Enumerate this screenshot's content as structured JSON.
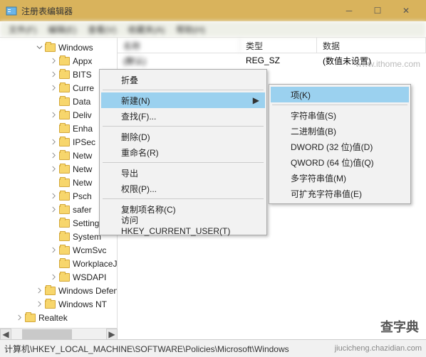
{
  "window": {
    "title": "注册表编辑器"
  },
  "menubar": [
    "文件(F)",
    "编辑(E)",
    "查看(V)",
    "收藏夹(A)",
    "帮助(H)"
  ],
  "tree": {
    "root": "Windows",
    "items": [
      {
        "l": "Appx",
        "e": true
      },
      {
        "l": "BITS",
        "e": true
      },
      {
        "l": "Curre",
        "e": true
      },
      {
        "l": "Data",
        "e": false
      },
      {
        "l": "Deliv",
        "e": true
      },
      {
        "l": "Enha",
        "e": false
      },
      {
        "l": "IPSec",
        "e": true
      },
      {
        "l": "Netw",
        "e": true
      },
      {
        "l": "Netw",
        "e": true
      },
      {
        "l": "Netw",
        "e": false
      },
      {
        "l": "Psch",
        "e": true
      },
      {
        "l": "safer",
        "e": true
      },
      {
        "l": "SettingSync",
        "e": false
      },
      {
        "l": "System",
        "e": false
      },
      {
        "l": "WcmSvc",
        "e": true
      },
      {
        "l": "WorkplaceJoi",
        "e": false
      },
      {
        "l": "WSDAPI",
        "e": true
      }
    ],
    "siblings": [
      "Windows Defend",
      "Windows NT"
    ],
    "outer": "Realtek"
  },
  "list": {
    "headers": {
      "name": "名称",
      "type": "类型",
      "data": "数据"
    },
    "rows": [
      {
        "name": "(默认)",
        "type": "REG_SZ",
        "data": "(数值未设置)"
      }
    ]
  },
  "ctx1": {
    "collapse": "折叠",
    "new": "新建(N)",
    "find": "查找(F)...",
    "del": "删除(D)",
    "rename": "重命名(R)",
    "export": "导出",
    "perm": "权限(P)...",
    "copyname": "复制项名称(C)",
    "goto": "访问 HKEY_CURRENT_USER(T)"
  },
  "ctx2": {
    "key": "项(K)",
    "string": "字符串值(S)",
    "binary": "二进制值(B)",
    "dword": "DWORD (32 位)值(D)",
    "qword": "QWORD (64 位)值(Q)",
    "multi": "多字符串值(M)",
    "expand": "可扩充字符串值(E)"
  },
  "statusbar": "计算机\\HKEY_LOCAL_MACHINE\\SOFTWARE\\Policies\\Microsoft\\Windows",
  "watermarks": {
    "wm1": "www.ithome.com",
    "wm2": "jiucicheng.chazidian.com",
    "wm3": "查字典"
  }
}
